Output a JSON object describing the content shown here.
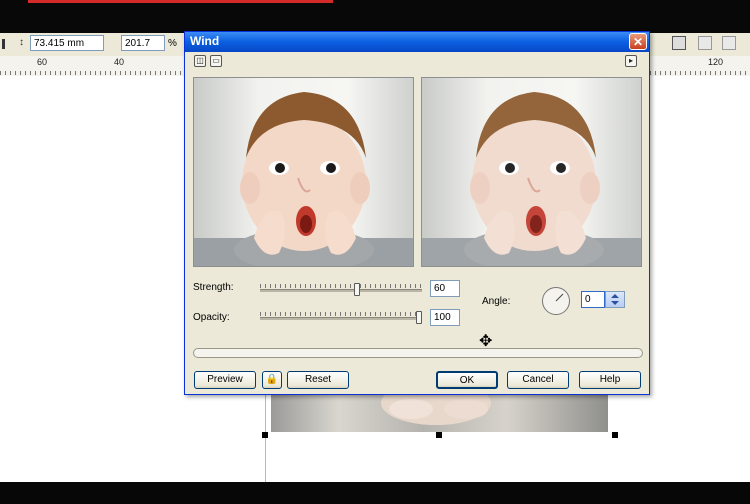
{
  "toolbar": {
    "field1_value": "73.415 mm",
    "field2_value": "201.7",
    "percent_label": "%"
  },
  "ruler": {
    "labels": [
      "60",
      "40",
      "120"
    ]
  },
  "dialog": {
    "title": "Wind",
    "strength_label": "Strength:",
    "strength_value": "60",
    "strength_level": 60,
    "opacity_label": "Opacity:",
    "opacity_value": "100",
    "opacity_level": 100,
    "angle_label": "Angle:",
    "angle_value": "0",
    "buttons": {
      "preview": "Preview",
      "reset": "Reset",
      "ok": "OK",
      "cancel": "Cancel",
      "help": "Help"
    }
  },
  "colors": {
    "title_bar": "#0a5fe0",
    "dialog_bg": "#ece9d8",
    "close_button": "#c8401f"
  }
}
